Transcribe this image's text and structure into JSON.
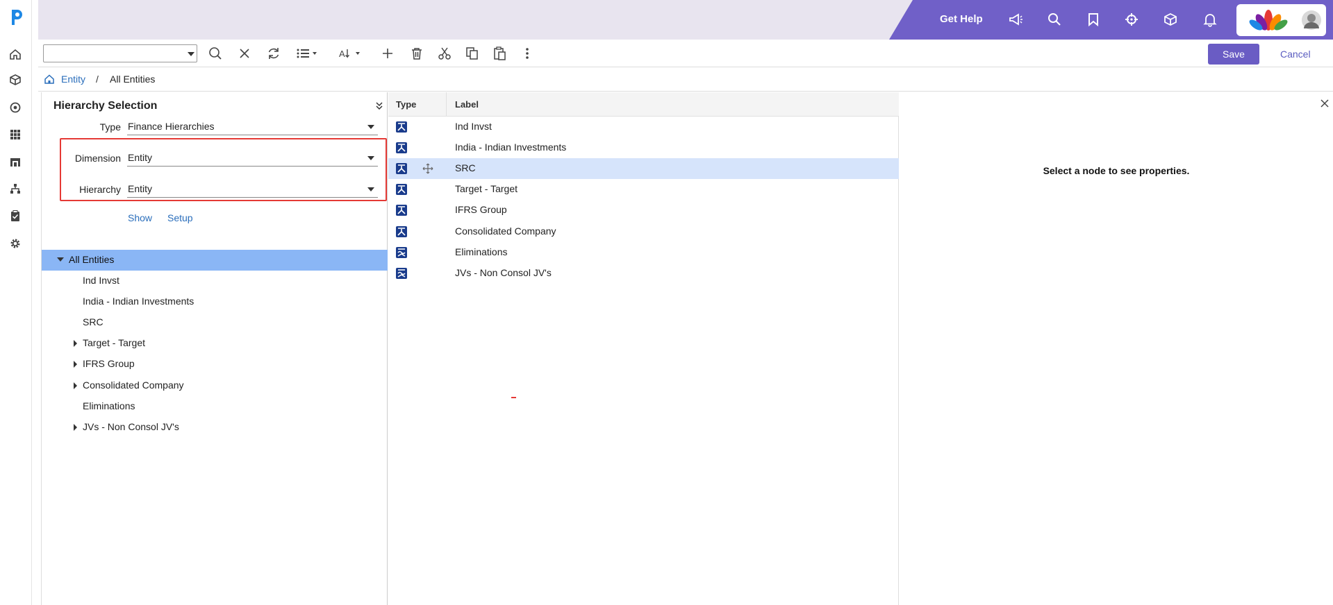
{
  "topbar": {
    "get_help": "Get Help",
    "icons": [
      "megaphone-icon",
      "search-icon",
      "bookmark-icon",
      "crosshair-icon",
      "cube-icon",
      "bell-icon"
    ]
  },
  "sidebar": {
    "icons": [
      "home-icon",
      "cube-icon",
      "target-icon",
      "grid-icon",
      "building-icon",
      "hierarchy-icon",
      "clipboard-icon",
      "gear-icon"
    ]
  },
  "toolbar": {
    "select_value": "",
    "save_label": "Save",
    "cancel_label": "Cancel"
  },
  "breadcrumb": {
    "items": [
      "Entity",
      "All Entities"
    ],
    "separator": "/"
  },
  "hierarchy_selection": {
    "title": "Hierarchy Selection",
    "type_label": "Type",
    "type_value": "Finance Hierarchies",
    "dimension_label": "Dimension",
    "dimension_value": "Entity",
    "hierarchy_label": "Hierarchy",
    "hierarchy_value": "Entity",
    "show_label": "Show",
    "setup_label": "Setup"
  },
  "tree": {
    "root": "All Entities",
    "children": [
      "Ind Invst",
      "India - Indian Investments",
      "SRC",
      "Target - Target",
      "IFRS Group",
      "Consolidated Company",
      "Eliminations",
      "JVs - Non Consol JV's"
    ]
  },
  "grid": {
    "headers": [
      "Type",
      "Label"
    ],
    "rows": [
      "Ind Invst",
      "India - Indian Investments",
      "SRC",
      "Target - Target",
      "IFRS Group",
      "Consolidated Company",
      "Eliminations",
      "JVs - Non Consol JV's"
    ],
    "selected_row": "SRC"
  },
  "properties": {
    "message": "Select a node to see properties."
  },
  "colors": {
    "accent": "#7060c8",
    "tree_selected": "#8ab6f5",
    "row_selected": "#d6e4fb",
    "highlight_box": "#e53935",
    "link": "#2a6ebb"
  }
}
